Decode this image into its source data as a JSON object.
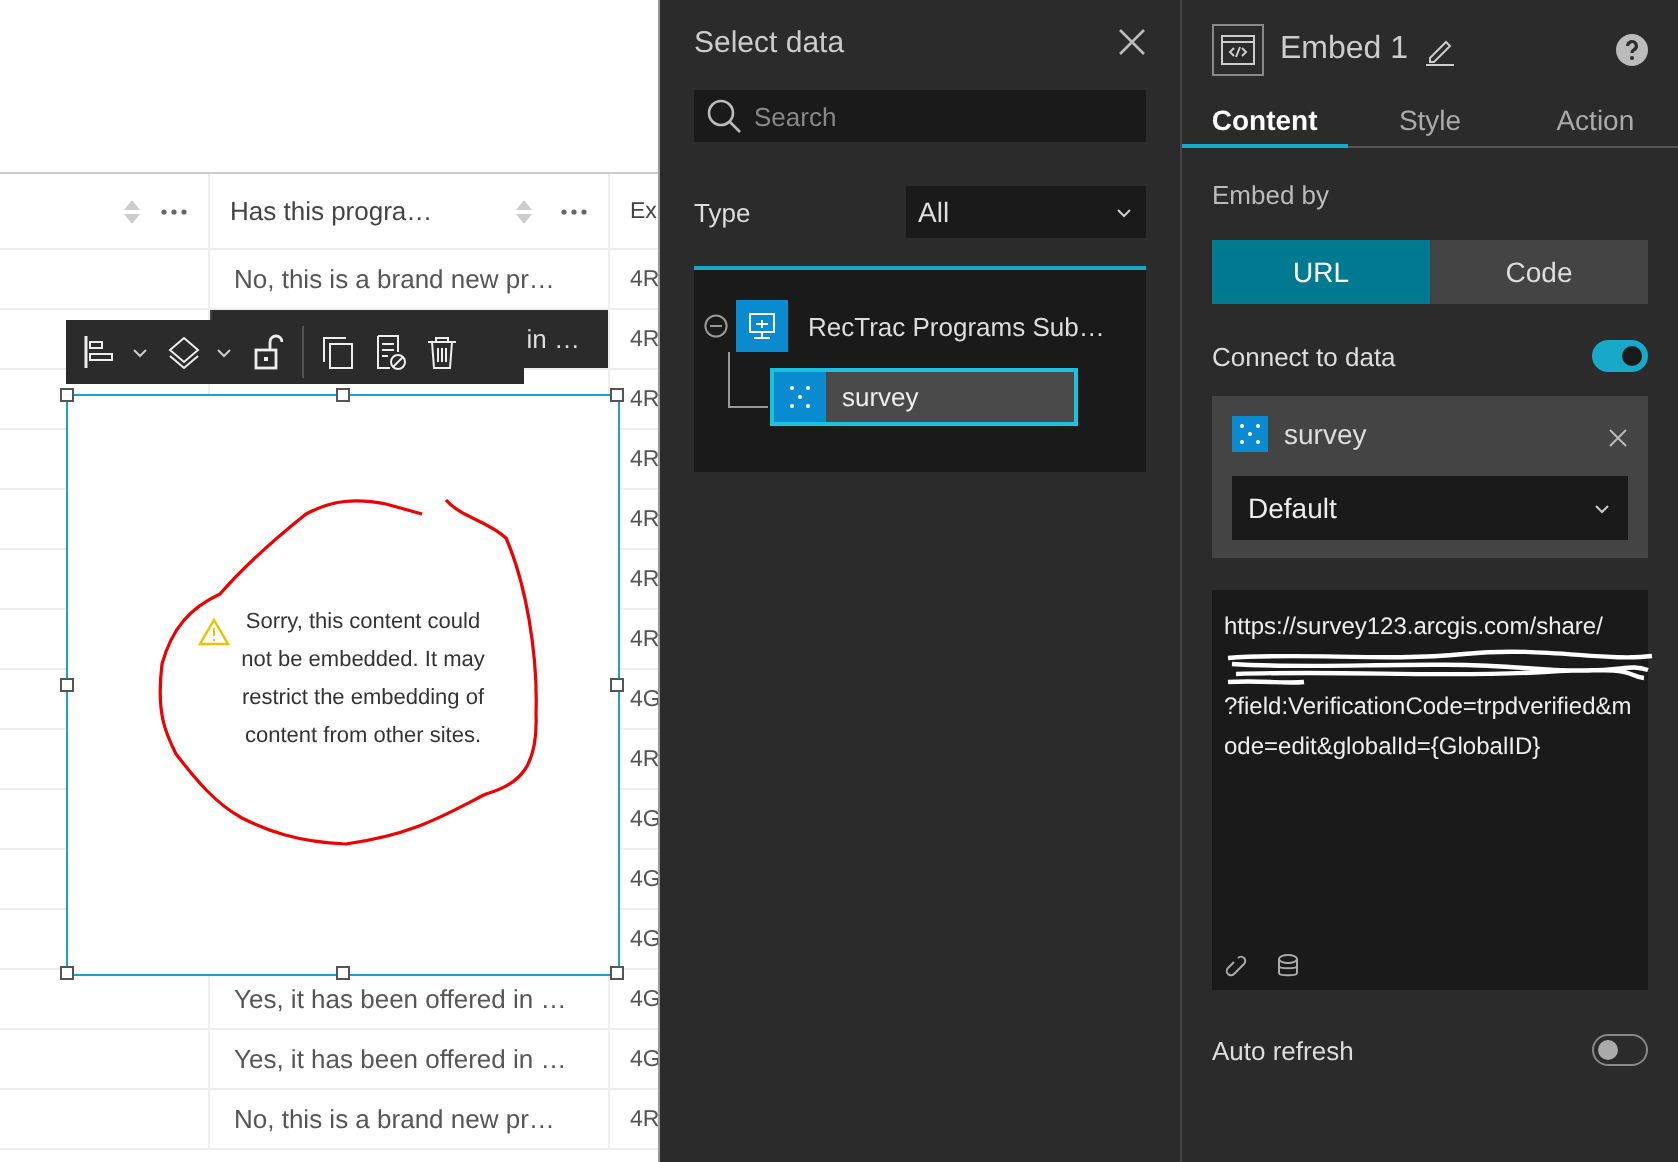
{
  "table": {
    "columns": [
      {
        "kind": "blank"
      },
      {
        "kind": "titled",
        "label": "Has this progra…"
      },
      {
        "kind": "cut",
        "label": "Ex"
      }
    ],
    "rows": [
      {
        "column_2": "No, this is a brand new pr…",
        "column_3": "4R"
      },
      {
        "column_2": "in …",
        "column_3": "4R"
      },
      {
        "column_3": "4R"
      },
      {
        "column_3": "4R"
      },
      {
        "column_3": "4R"
      },
      {
        "column_3": "4R"
      },
      {
        "column_3": "4R"
      },
      {
        "column_3": "4G"
      },
      {
        "column_3": "4R"
      },
      {
        "column_3": "4G"
      },
      {
        "column_3": "4G"
      },
      {
        "column_3": "4G"
      },
      {
        "column_2": "Yes, it has been offered in …",
        "column_3": "4G"
      },
      {
        "column_2": "Yes, it has been offered in …",
        "column_3": "4G"
      },
      {
        "column_2": "No, this is a brand new pr…",
        "column_3": "4R"
      }
    ]
  },
  "embed_widget": {
    "message": "Sorry, this content could not be embedded. It may restrict the embedding of content from other sites."
  },
  "select_data": {
    "title": "Select data",
    "search": {
      "placeholder": "Search"
    },
    "type_label": "Type",
    "type_value": "All",
    "tree": [
      {
        "label": "RecTrac Programs Sub…",
        "expanded": true,
        "children": [
          {
            "label": "survey",
            "selected": true
          }
        ]
      }
    ]
  },
  "settings": {
    "title": "Embed 1",
    "tabs": [
      {
        "label": "Content",
        "selected": true
      },
      {
        "label": "Style",
        "selected": false
      },
      {
        "label": "Action",
        "selected": false
      }
    ],
    "embed_by_label": "Embed by",
    "embed_by": [
      {
        "label": "URL",
        "selected": true
      },
      {
        "label": "Code",
        "selected": false
      }
    ],
    "connect_label": "Connect to data",
    "connect_on": true,
    "data_source": {
      "name": "survey",
      "view": "Default"
    },
    "url_before": "https://survey123.arcgis.com/share/",
    "url_after": "?field:VerificationCode=trpdverified&mode=edit&globalId={GlobalID}",
    "auto_refresh_label": "Auto refresh",
    "auto_refresh_on": false
  }
}
